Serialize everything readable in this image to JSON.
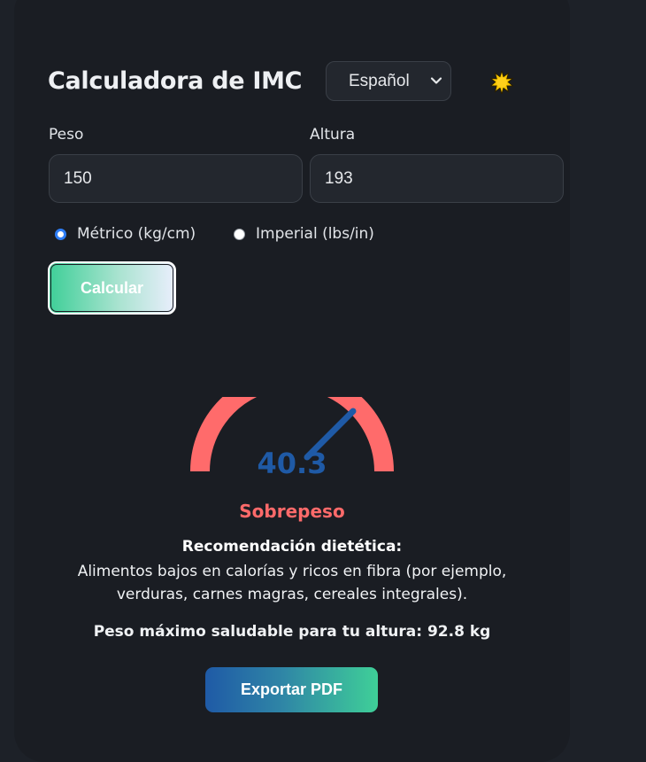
{
  "header": {
    "title": "Calculadora de IMC",
    "language_selected": "Español",
    "theme_icon": "sun-icon"
  },
  "form": {
    "weight_label": "Peso",
    "weight_value": "150",
    "height_label": "Altura",
    "height_value": "193",
    "units": {
      "metric_label": "Métrico (kg/cm)",
      "imperial_label": "Imperial (lbs/in)",
      "selected": "metric"
    },
    "calculate_label": "Calcular"
  },
  "result": {
    "bmi": "40.3",
    "category": "Sobrepeso",
    "recommendation_title": "Recomendación dietética:",
    "recommendation_line1": "Alimentos bajos en calorías y ricos en fibra (por ejemplo,",
    "recommendation_line2": "verduras, carnes magras, cereales integrales).",
    "max_weight_text": "Peso máximo saludable para tu altura:",
    "max_weight_value": "92.8 kg"
  },
  "actions": {
    "export_label": "Exportar PDF"
  },
  "colors": {
    "gauge_arc": "#ff6b6b",
    "needle": "#1f5aa6",
    "category": "#ff6a6a"
  }
}
